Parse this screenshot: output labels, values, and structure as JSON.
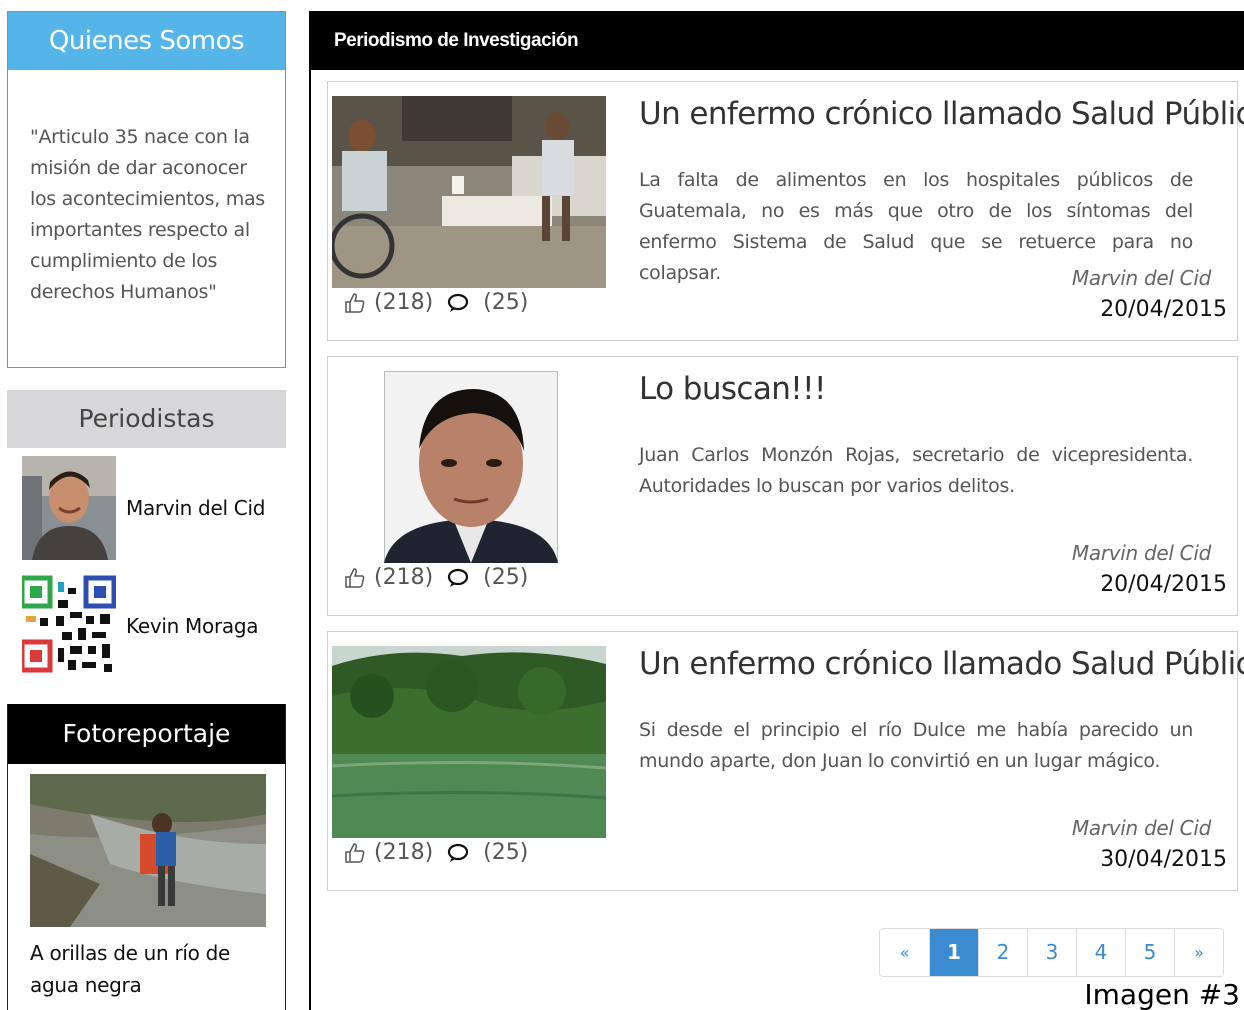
{
  "sidebar": {
    "about": {
      "title": "Quienes Somos",
      "text": "\"Articulo 35 nace con la misión de dar aconocer los acontecimientos, mas importantes respecto al cumplimiento de los derechos Humanos\""
    },
    "journalists": {
      "title": "Periodistas",
      "items": [
        {
          "name": "Marvin del Cid"
        },
        {
          "name": "Kevin Moraga"
        }
      ]
    },
    "photo_report": {
      "title": "Fotoreportaje",
      "caption": "A orillas de un río de agua negra"
    }
  },
  "main": {
    "header": "Periodismo de Investigación",
    "articles": [
      {
        "title": "Un enfermo crónico llamado Salud Pública",
        "excerpt": "La falta de alimentos en los hospitales públicos de Guatemala, no es más que otro de los síntomas del enfermo Sistema de Salud que se retuerce para no colapsar.",
        "likes": "(218)",
        "comments": "(25)",
        "author": "Marvin del Cid",
        "date": "20/04/2015"
      },
      {
        "title": "Lo buscan!!!",
        "excerpt": "Juan Carlos Monzón Rojas, secretario de vicepresidenta. Autoridades lo buscan por varios delitos.",
        "likes": "(218)",
        "comments": "(25)",
        "author": "Marvin del Cid",
        "date": "20/04/2015"
      },
      {
        "title": "Un enfermo crónico llamado Salud Pública",
        "excerpt": "Si desde el principio el río Dulce me había parecido un mundo aparte, don Juan lo convirtió en un lugar mágico.",
        "likes": "(218)",
        "comments": "(25)",
        "author": "Marvin del Cid",
        "date": "30/04/2015"
      }
    ],
    "pagination": [
      "«",
      "1",
      "2",
      "3",
      "4",
      "5",
      "»"
    ],
    "pagination_active": "1"
  },
  "image_label": "Imagen #3",
  "icons": [
    "thumbs-up-icon",
    "comment-icon"
  ],
  "colors": {
    "about_header": "#55b4e8",
    "pager_active": "#3b8bd0",
    "main_header": "#000000"
  }
}
